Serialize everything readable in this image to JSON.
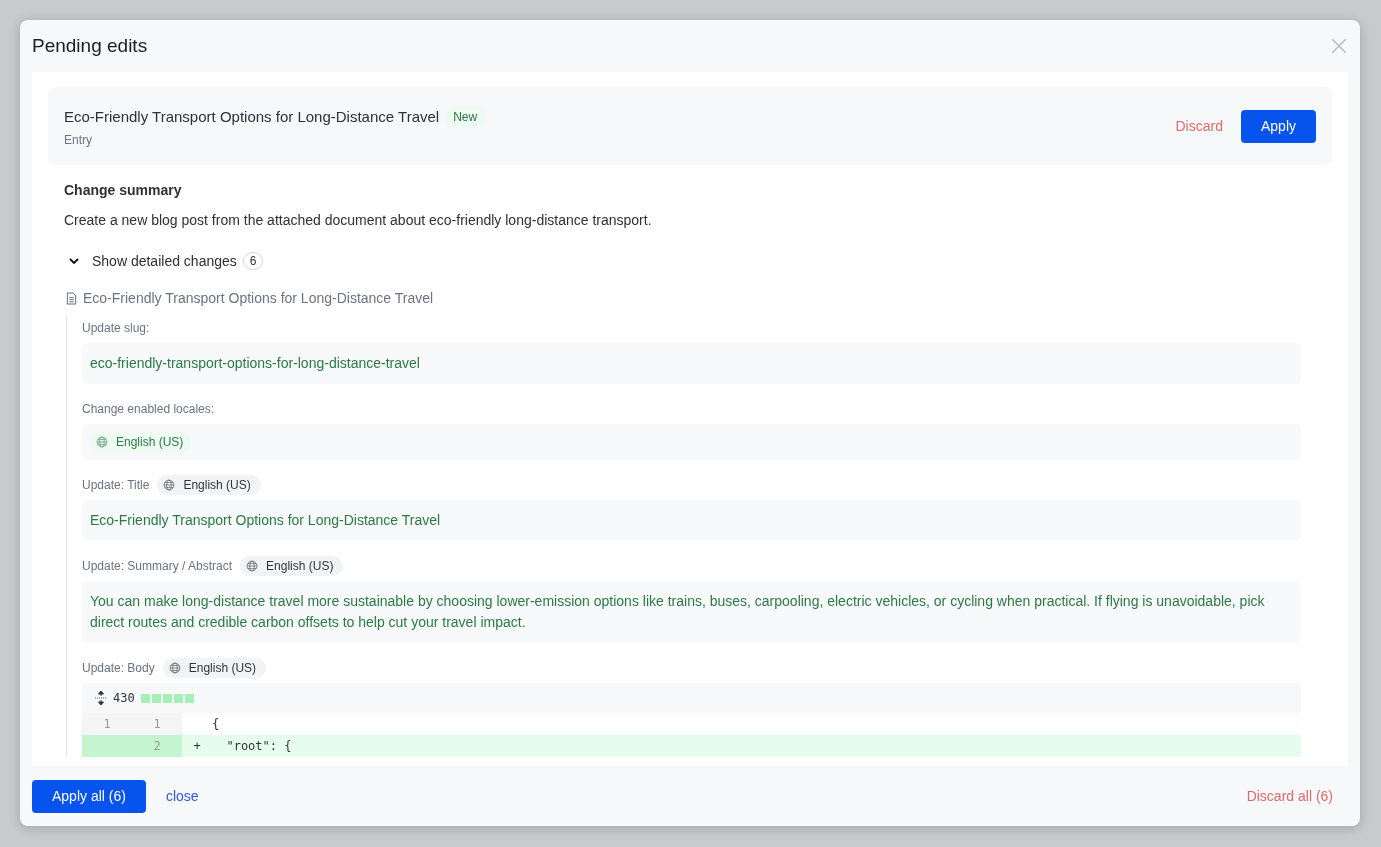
{
  "dialog": {
    "title": "Pending edits"
  },
  "entry": {
    "title": "Eco-Friendly Transport Options for Long-Distance Travel",
    "badge": "New",
    "type": "Entry",
    "discard": "Discard",
    "apply": "Apply"
  },
  "summary": {
    "heading": "Change summary",
    "text": "Create a new blog post from the attached document about eco-friendly long-distance transport.",
    "toggle": "Show detailed changes",
    "count": "6",
    "expanded": true
  },
  "document": {
    "title": "Eco-Friendly Transport Options for Long-Distance Travel",
    "changes": [
      {
        "kind": "text",
        "label": "Update slug:",
        "value": "eco-friendly-transport-options-for-long-distance-travel"
      },
      {
        "kind": "locales",
        "label": "Change enabled locales:",
        "locales": [
          "English (US)"
        ]
      },
      {
        "kind": "text",
        "label": "Update: Title",
        "locale": "English (US)",
        "value": "Eco-Friendly Transport Options for Long-Distance Travel"
      },
      {
        "kind": "text",
        "label": "Update: Summary / Abstract",
        "locale": "English (US)",
        "value": "You can make long-distance travel more sustainable by choosing lower-emission options like trains, buses, carpooling, electric vehicles, or cycling when practical. If flying is unavoidable, pick direct routes and credible carbon offsets to help cut your travel impact."
      },
      {
        "kind": "diff",
        "label": "Update: Body",
        "locale": "English (US)",
        "stat": "430",
        "lines": [
          {
            "kind": "context",
            "old": "1",
            "new": "1",
            "code": "{"
          },
          {
            "kind": "added",
            "new": "2",
            "sign": "+",
            "code": "  \"root\": {"
          }
        ]
      }
    ]
  },
  "footer": {
    "apply_all": "Apply all (6)",
    "close": "close",
    "discard_all": "Discard all (6)"
  }
}
